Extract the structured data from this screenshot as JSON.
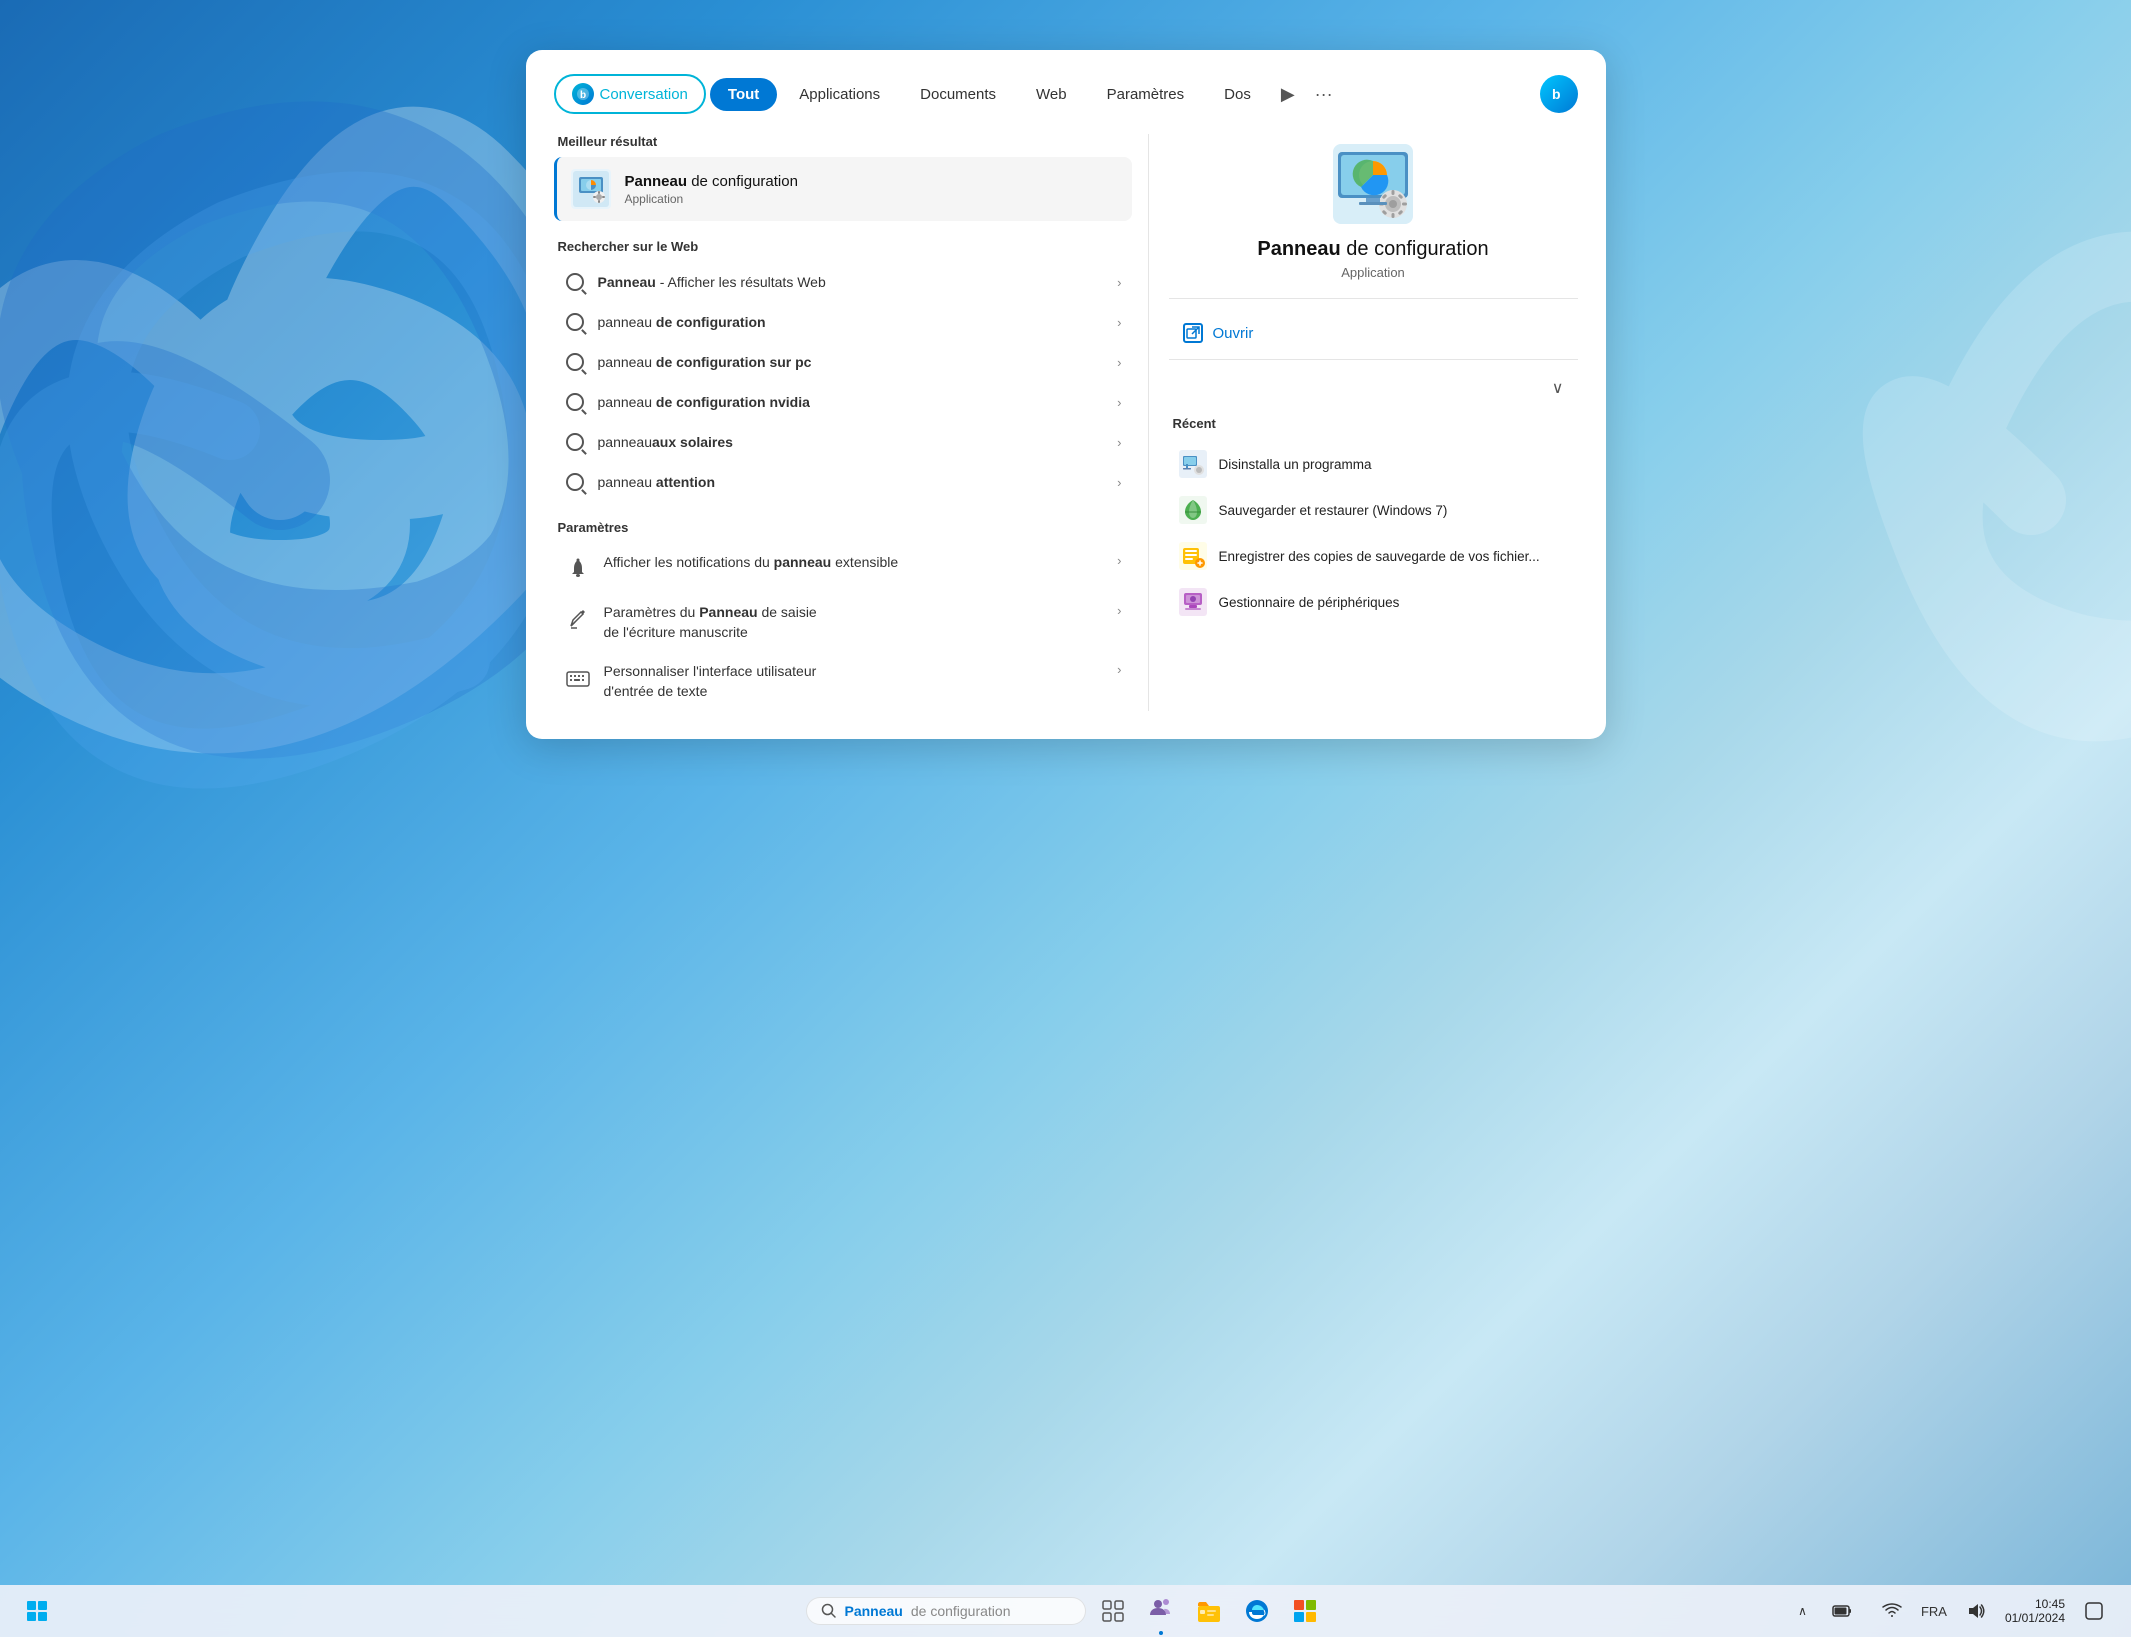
{
  "desktop": {
    "bg_gradient": "linear-gradient(135deg, #1a6bb5 0%, #2a8fd4 20%, #5ab4e8 40%, #87ceeb 55%, #a8d8ea 65%, #c8e8f5 75%, #b0d4e8 85%, #7ab5d8 100%)"
  },
  "search_panel": {
    "tabs": [
      {
        "id": "conversation",
        "label": "Conversation",
        "active": false,
        "special": true
      },
      {
        "id": "tout",
        "label": "Tout",
        "active": true
      },
      {
        "id": "applications",
        "label": "Applications",
        "active": false
      },
      {
        "id": "documents",
        "label": "Documents",
        "active": false
      },
      {
        "id": "web",
        "label": "Web",
        "active": false
      },
      {
        "id": "parametres",
        "label": "Paramètres",
        "active": false
      },
      {
        "id": "dos",
        "label": "Dos",
        "active": false
      }
    ],
    "best_result": {
      "section_title": "Meilleur résultat",
      "name_part1": "Panneau",
      "name_part2": " de configuration",
      "type": "Application"
    },
    "web_search": {
      "section_title": "Rechercher sur le Web",
      "items": [
        {
          "text_normal": "Panneau",
          "text_suffix": " - Afficher les résultats Web"
        },
        {
          "text_prefix": "panneau ",
          "text_bold": "de configuration"
        },
        {
          "text_prefix": "panneau ",
          "text_bold": "de configuration sur pc"
        },
        {
          "text_prefix": "panneau ",
          "text_bold": "de configuration nvidia"
        },
        {
          "text_prefix": "panneau",
          "text_bold": "aux solaires"
        },
        {
          "text_prefix": "panneau ",
          "text_bold": "attention"
        }
      ]
    },
    "parametres_section": {
      "section_title": "Paramètres",
      "items": [
        {
          "line1_normal": "Afficher les notifications du",
          "line1_bold": " panneau",
          "line2_normal": " extensible",
          "icon_type": "bell"
        },
        {
          "line1_normal": "Paramètres du ",
          "line1_bold": "Panneau",
          "line2_normal": " de saisie\nde l'écriture manuscrite",
          "icon_type": "pen"
        },
        {
          "line1_normal": "Personnaliser l'interface utilisateur\nd'entrée de texte",
          "icon_type": "keyboard"
        }
      ]
    },
    "right_panel": {
      "app_name_bold": "Panneau",
      "app_name_normal": " de configuration",
      "app_type": "Application",
      "open_label": "Ouvrir",
      "recent_title": "Récent",
      "recent_items": [
        {
          "text": "Disinstalla un programma"
        },
        {
          "text": "Sauvegarder et restaurer (Windows 7)"
        },
        {
          "text": "Enregistrer des copies de sauvegarde de vos fichier..."
        },
        {
          "text": "Gestionnaire de périphériques"
        }
      ]
    }
  },
  "taskbar": {
    "search_value": "Panneau",
    "search_suffix": "de configuration",
    "lang": "FRA",
    "icons": [
      "start",
      "search",
      "taskview",
      "teams",
      "explorer",
      "edge",
      "store"
    ]
  }
}
